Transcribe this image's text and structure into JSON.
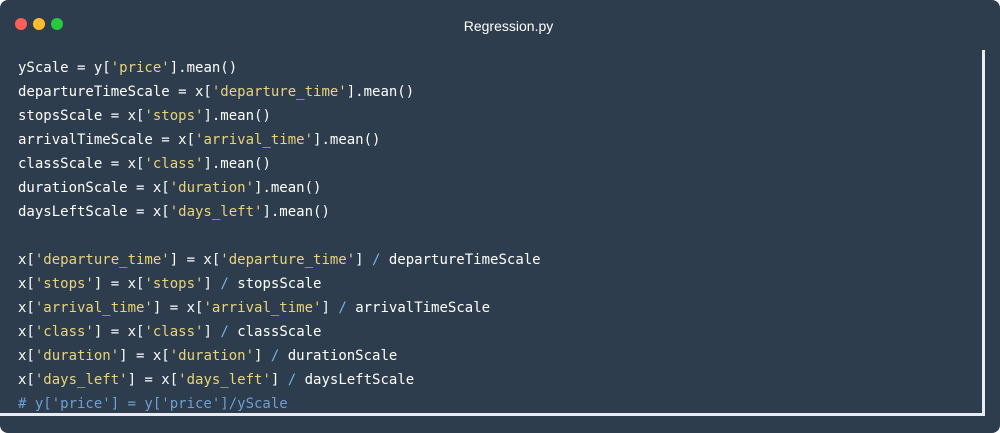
{
  "window": {
    "title": "Regression.py",
    "controls": {
      "close_color": "#ff5f56",
      "minimize_color": "#ffbd2e",
      "maximize_color": "#27c93f"
    }
  },
  "colors": {
    "background": "#2d3d4e",
    "text": "#ffffff",
    "string": "#e8d37a",
    "operator": "#6fb6e6",
    "comment": "#6f9fd1"
  },
  "code": {
    "lines": [
      [
        {
          "t": "yScale = y["
        },
        {
          "t": "'price'",
          "k": "str"
        },
        {
          "t": "].mean()"
        }
      ],
      [
        {
          "t": "departureTimeScale = x["
        },
        {
          "t": "'departure_time'",
          "k": "str"
        },
        {
          "t": "].mean()"
        }
      ],
      [
        {
          "t": "stopsScale = x["
        },
        {
          "t": "'stops'",
          "k": "str"
        },
        {
          "t": "].mean()"
        }
      ],
      [
        {
          "t": "arrivalTimeScale = x["
        },
        {
          "t": "'arrival_time'",
          "k": "str"
        },
        {
          "t": "].mean()"
        }
      ],
      [
        {
          "t": "classScale = x["
        },
        {
          "t": "'class'",
          "k": "str"
        },
        {
          "t": "].mean()"
        }
      ],
      [
        {
          "t": "durationScale = x["
        },
        {
          "t": "'duration'",
          "k": "str"
        },
        {
          "t": "].mean()"
        }
      ],
      [
        {
          "t": "daysLeftScale = x["
        },
        {
          "t": "'days_left'",
          "k": "str"
        },
        {
          "t": "].mean()"
        }
      ],
      [],
      [
        {
          "t": "x["
        },
        {
          "t": "'departure_time'",
          "k": "str"
        },
        {
          "t": "] = x["
        },
        {
          "t": "'departure_time'",
          "k": "str"
        },
        {
          "t": "] "
        },
        {
          "t": "/",
          "k": "op"
        },
        {
          "t": " departureTimeScale"
        }
      ],
      [
        {
          "t": "x["
        },
        {
          "t": "'stops'",
          "k": "str"
        },
        {
          "t": "] = x["
        },
        {
          "t": "'stops'",
          "k": "str"
        },
        {
          "t": "] "
        },
        {
          "t": "/",
          "k": "op"
        },
        {
          "t": " stopsScale"
        }
      ],
      [
        {
          "t": "x["
        },
        {
          "t": "'arrival_time'",
          "k": "str"
        },
        {
          "t": "] = x["
        },
        {
          "t": "'arrival_time'",
          "k": "str"
        },
        {
          "t": "] "
        },
        {
          "t": "/",
          "k": "op"
        },
        {
          "t": " arrivalTimeScale"
        }
      ],
      [
        {
          "t": "x["
        },
        {
          "t": "'class'",
          "k": "str"
        },
        {
          "t": "] = x["
        },
        {
          "t": "'class'",
          "k": "str"
        },
        {
          "t": "] "
        },
        {
          "t": "/",
          "k": "op"
        },
        {
          "t": " classScale"
        }
      ],
      [
        {
          "t": "x["
        },
        {
          "t": "'duration'",
          "k": "str"
        },
        {
          "t": "] = x["
        },
        {
          "t": "'duration'",
          "k": "str"
        },
        {
          "t": "] "
        },
        {
          "t": "/",
          "k": "op"
        },
        {
          "t": " durationScale"
        }
      ],
      [
        {
          "t": "x["
        },
        {
          "t": "'days_left'",
          "k": "str"
        },
        {
          "t": "] = x["
        },
        {
          "t": "'days_left'",
          "k": "str"
        },
        {
          "t": "] "
        },
        {
          "t": "/",
          "k": "op"
        },
        {
          "t": " daysLeftScale"
        }
      ],
      [
        {
          "t": "# y['price'] = y['price']/yScale",
          "k": "cmt"
        }
      ]
    ]
  }
}
